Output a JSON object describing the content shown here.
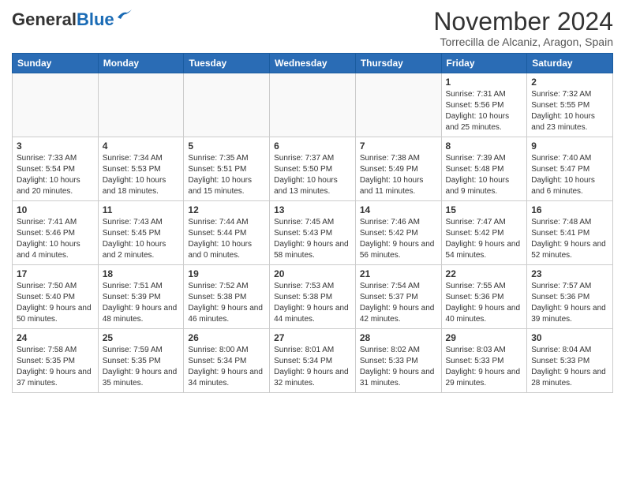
{
  "header": {
    "logo_general": "General",
    "logo_blue": "Blue",
    "month_title": "November 2024",
    "subtitle": "Torrecilla de Alcaniz, Aragon, Spain"
  },
  "weekdays": [
    "Sunday",
    "Monday",
    "Tuesday",
    "Wednesday",
    "Thursday",
    "Friday",
    "Saturday"
  ],
  "weeks": [
    [
      {
        "day": "",
        "info": ""
      },
      {
        "day": "",
        "info": ""
      },
      {
        "day": "",
        "info": ""
      },
      {
        "day": "",
        "info": ""
      },
      {
        "day": "",
        "info": ""
      },
      {
        "day": "1",
        "info": "Sunrise: 7:31 AM\nSunset: 5:56 PM\nDaylight: 10 hours and 25 minutes."
      },
      {
        "day": "2",
        "info": "Sunrise: 7:32 AM\nSunset: 5:55 PM\nDaylight: 10 hours and 23 minutes."
      }
    ],
    [
      {
        "day": "3",
        "info": "Sunrise: 7:33 AM\nSunset: 5:54 PM\nDaylight: 10 hours and 20 minutes."
      },
      {
        "day": "4",
        "info": "Sunrise: 7:34 AM\nSunset: 5:53 PM\nDaylight: 10 hours and 18 minutes."
      },
      {
        "day": "5",
        "info": "Sunrise: 7:35 AM\nSunset: 5:51 PM\nDaylight: 10 hours and 15 minutes."
      },
      {
        "day": "6",
        "info": "Sunrise: 7:37 AM\nSunset: 5:50 PM\nDaylight: 10 hours and 13 minutes."
      },
      {
        "day": "7",
        "info": "Sunrise: 7:38 AM\nSunset: 5:49 PM\nDaylight: 10 hours and 11 minutes."
      },
      {
        "day": "8",
        "info": "Sunrise: 7:39 AM\nSunset: 5:48 PM\nDaylight: 10 hours and 9 minutes."
      },
      {
        "day": "9",
        "info": "Sunrise: 7:40 AM\nSunset: 5:47 PM\nDaylight: 10 hours and 6 minutes."
      }
    ],
    [
      {
        "day": "10",
        "info": "Sunrise: 7:41 AM\nSunset: 5:46 PM\nDaylight: 10 hours and 4 minutes."
      },
      {
        "day": "11",
        "info": "Sunrise: 7:43 AM\nSunset: 5:45 PM\nDaylight: 10 hours and 2 minutes."
      },
      {
        "day": "12",
        "info": "Sunrise: 7:44 AM\nSunset: 5:44 PM\nDaylight: 10 hours and 0 minutes."
      },
      {
        "day": "13",
        "info": "Sunrise: 7:45 AM\nSunset: 5:43 PM\nDaylight: 9 hours and 58 minutes."
      },
      {
        "day": "14",
        "info": "Sunrise: 7:46 AM\nSunset: 5:42 PM\nDaylight: 9 hours and 56 minutes."
      },
      {
        "day": "15",
        "info": "Sunrise: 7:47 AM\nSunset: 5:42 PM\nDaylight: 9 hours and 54 minutes."
      },
      {
        "day": "16",
        "info": "Sunrise: 7:48 AM\nSunset: 5:41 PM\nDaylight: 9 hours and 52 minutes."
      }
    ],
    [
      {
        "day": "17",
        "info": "Sunrise: 7:50 AM\nSunset: 5:40 PM\nDaylight: 9 hours and 50 minutes."
      },
      {
        "day": "18",
        "info": "Sunrise: 7:51 AM\nSunset: 5:39 PM\nDaylight: 9 hours and 48 minutes."
      },
      {
        "day": "19",
        "info": "Sunrise: 7:52 AM\nSunset: 5:38 PM\nDaylight: 9 hours and 46 minutes."
      },
      {
        "day": "20",
        "info": "Sunrise: 7:53 AM\nSunset: 5:38 PM\nDaylight: 9 hours and 44 minutes."
      },
      {
        "day": "21",
        "info": "Sunrise: 7:54 AM\nSunset: 5:37 PM\nDaylight: 9 hours and 42 minutes."
      },
      {
        "day": "22",
        "info": "Sunrise: 7:55 AM\nSunset: 5:36 PM\nDaylight: 9 hours and 40 minutes."
      },
      {
        "day": "23",
        "info": "Sunrise: 7:57 AM\nSunset: 5:36 PM\nDaylight: 9 hours and 39 minutes."
      }
    ],
    [
      {
        "day": "24",
        "info": "Sunrise: 7:58 AM\nSunset: 5:35 PM\nDaylight: 9 hours and 37 minutes."
      },
      {
        "day": "25",
        "info": "Sunrise: 7:59 AM\nSunset: 5:35 PM\nDaylight: 9 hours and 35 minutes."
      },
      {
        "day": "26",
        "info": "Sunrise: 8:00 AM\nSunset: 5:34 PM\nDaylight: 9 hours and 34 minutes."
      },
      {
        "day": "27",
        "info": "Sunrise: 8:01 AM\nSunset: 5:34 PM\nDaylight: 9 hours and 32 minutes."
      },
      {
        "day": "28",
        "info": "Sunrise: 8:02 AM\nSunset: 5:33 PM\nDaylight: 9 hours and 31 minutes."
      },
      {
        "day": "29",
        "info": "Sunrise: 8:03 AM\nSunset: 5:33 PM\nDaylight: 9 hours and 29 minutes."
      },
      {
        "day": "30",
        "info": "Sunrise: 8:04 AM\nSunset: 5:33 PM\nDaylight: 9 hours and 28 minutes."
      }
    ]
  ]
}
